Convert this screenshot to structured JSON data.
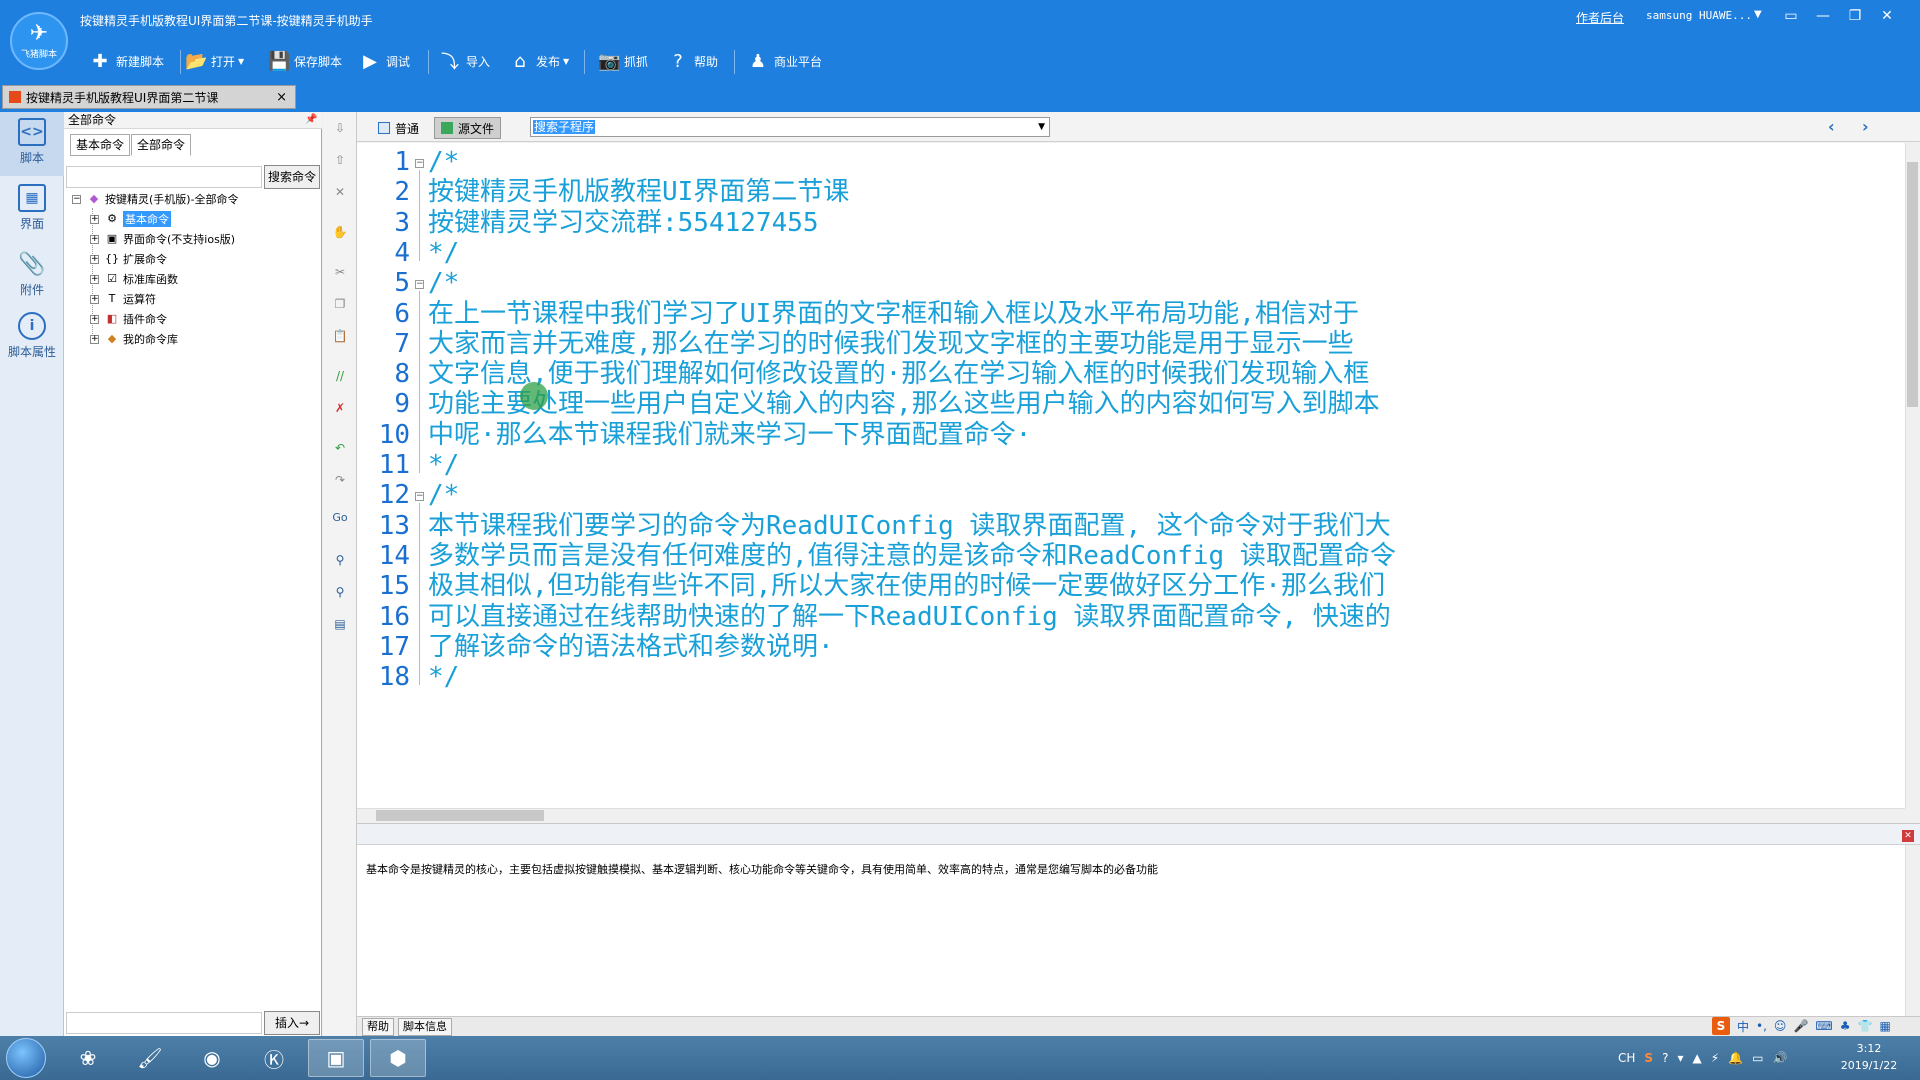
{
  "window": {
    "title": "按键精灵手机版教程UI界面第二节课-按键精灵手机助手",
    "logo_text": "飞猪脚本",
    "author_link": "作者后台",
    "device": "samsung  HUAWE...",
    "controls": [
      "▭",
      "—",
      "❐",
      "✕"
    ]
  },
  "toolbar": [
    {
      "label": "新建脚本",
      "icon": "plus-icon",
      "glyph": "✚",
      "dropdown": false
    },
    {
      "label": "打开",
      "icon": "folder-icon",
      "glyph": "📂",
      "dropdown": true
    },
    {
      "label": "保存脚本",
      "icon": "save-icon",
      "glyph": "💾",
      "dropdown": false
    },
    {
      "label": "调试",
      "icon": "play-icon",
      "glyph": "▶",
      "dropdown": false
    },
    {
      "label": "导入",
      "icon": "import-icon",
      "glyph": "⤵",
      "dropdown": false
    },
    {
      "label": "发布",
      "icon": "publish-icon",
      "glyph": "⌂",
      "dropdown": true
    },
    {
      "label": "抓抓",
      "icon": "camera-icon",
      "glyph": "📷",
      "dropdown": false
    },
    {
      "label": "帮助",
      "icon": "help-icon",
      "glyph": "?",
      "dropdown": false
    },
    {
      "label": "商业平台",
      "icon": "business-icon",
      "glyph": "♟",
      "dropdown": false
    }
  ],
  "doc_tab": {
    "label": "按键精灵手机版教程UI界面第二节课",
    "close": "×"
  },
  "sidebar": [
    {
      "label": "脚本",
      "icon": "script-icon",
      "glyph": "<>",
      "active": true
    },
    {
      "label": "界面",
      "icon": "layout-icon",
      "glyph": "▦",
      "active": false
    },
    {
      "label": "附件",
      "icon": "attachment-icon",
      "glyph": "📎",
      "active": false
    },
    {
      "label": "脚本属性",
      "icon": "info-icon",
      "glyph": "i",
      "active": false
    }
  ],
  "command_panel": {
    "header": "全部命令",
    "tabs": [
      "基本命令",
      "全部命令"
    ],
    "search_button": "搜索命令",
    "search_value": "",
    "root": "按键精灵(手机版)-全部命令",
    "items": [
      {
        "label": "基本命令",
        "glyph": "⚙",
        "selected": true
      },
      {
        "label": "界面命令(不支持ios版)",
        "glyph": "▣",
        "selected": false
      },
      {
        "label": "扩展命令",
        "glyph": "{}",
        "selected": false
      },
      {
        "label": "标准库函数",
        "glyph": "☑",
        "selected": false
      },
      {
        "label": "运算符",
        "glyph": "T",
        "selected": false
      },
      {
        "label": "插件命令",
        "glyph": "◧",
        "selected": false
      },
      {
        "label": "我的命令库",
        "glyph": "◆",
        "selected": false
      }
    ],
    "insert_button": "插入→",
    "insert_value": ""
  },
  "editor": {
    "modes": [
      {
        "label": "普通",
        "active": false
      },
      {
        "label": "源文件",
        "active": true
      }
    ],
    "sub_select": "搜索子程序",
    "lines": [
      {
        "n": "1",
        "text": "/*",
        "fold": true
      },
      {
        "n": "2",
        "text": "按键精灵手机版教程UI界面第二节课",
        "fold": false
      },
      {
        "n": "3",
        "text": "按键精灵学习交流群:554127455",
        "fold": false
      },
      {
        "n": "4",
        "text": "*/",
        "fold": false
      },
      {
        "n": "5",
        "text": "/*",
        "fold": true
      },
      {
        "n": "6",
        "text": "在上一节课程中我们学习了UI界面的文字框和输入框以及水平布局功能,相信对于",
        "fold": false
      },
      {
        "n": "7",
        "text": "大家而言并无难度,那么在学习的时候我们发现文字框的主要功能是用于显示一些",
        "fold": false
      },
      {
        "n": "8",
        "text": "文字信息,便于我们理解如何修改设置的·那么在学习输入框的时候我们发现输入框",
        "fold": false
      },
      {
        "n": "9",
        "text": "功能主要处理一些用户自定义输入的内容,那么这些用户输入的内容如何写入到脚本",
        "fold": false
      },
      {
        "n": "10",
        "text": "中呢·那么本节课程我们就来学习一下界面配置命令·",
        "fold": false
      },
      {
        "n": "11",
        "text": "*/",
        "fold": false
      },
      {
        "n": "12",
        "text": "/*",
        "fold": true
      },
      {
        "n": "13",
        "text": "本节课程我们要学习的命令为ReadUIConfig 读取界面配置, 这个命令对于我们大",
        "fold": false
      },
      {
        "n": "14",
        "text": "多数学员而言是没有任何难度的,值得注意的是该命令和ReadConfig 读取配置命令",
        "fold": false
      },
      {
        "n": "15",
        "text": "极其相似,但功能有些许不同,所以大家在使用的时候一定要做好区分工作·那么我们",
        "fold": false
      },
      {
        "n": "16",
        "text": "可以直接通过在线帮助快速的了解一下ReadUIConfig 读取界面配置命令, 快速的",
        "fold": false
      },
      {
        "n": "17",
        "text": "了解该命令的语法格式和参数说明·",
        "fold": false
      },
      {
        "n": "18",
        "text": "*/",
        "fold": false
      }
    ]
  },
  "help": {
    "text": "基本命令是按键精灵的核心，主要包括虚拟按键触摸模拟、基本逻辑判断、核心功能命令等关键命令，具有使用简单、效率高的特点，通常是您编写脚本的必备功能",
    "tabs": [
      "帮助",
      "脚本信息"
    ]
  },
  "ime": {
    "logo": "S",
    "items": [
      "中",
      "•,",
      "☺",
      "🎤",
      "⌨",
      "♣",
      "👕",
      "▦"
    ]
  },
  "taskbar": {
    "apps": [
      "start",
      "photos-icon",
      "brush-icon",
      "color-icon",
      "k-icon",
      "robot-icon",
      "nox-icon"
    ],
    "tray": [
      "CH",
      "S",
      "?",
      "▾",
      "▲",
      "⚡",
      "🔔",
      "▭",
      "🔊"
    ],
    "time": "3:12",
    "date": "2019/1/22"
  }
}
